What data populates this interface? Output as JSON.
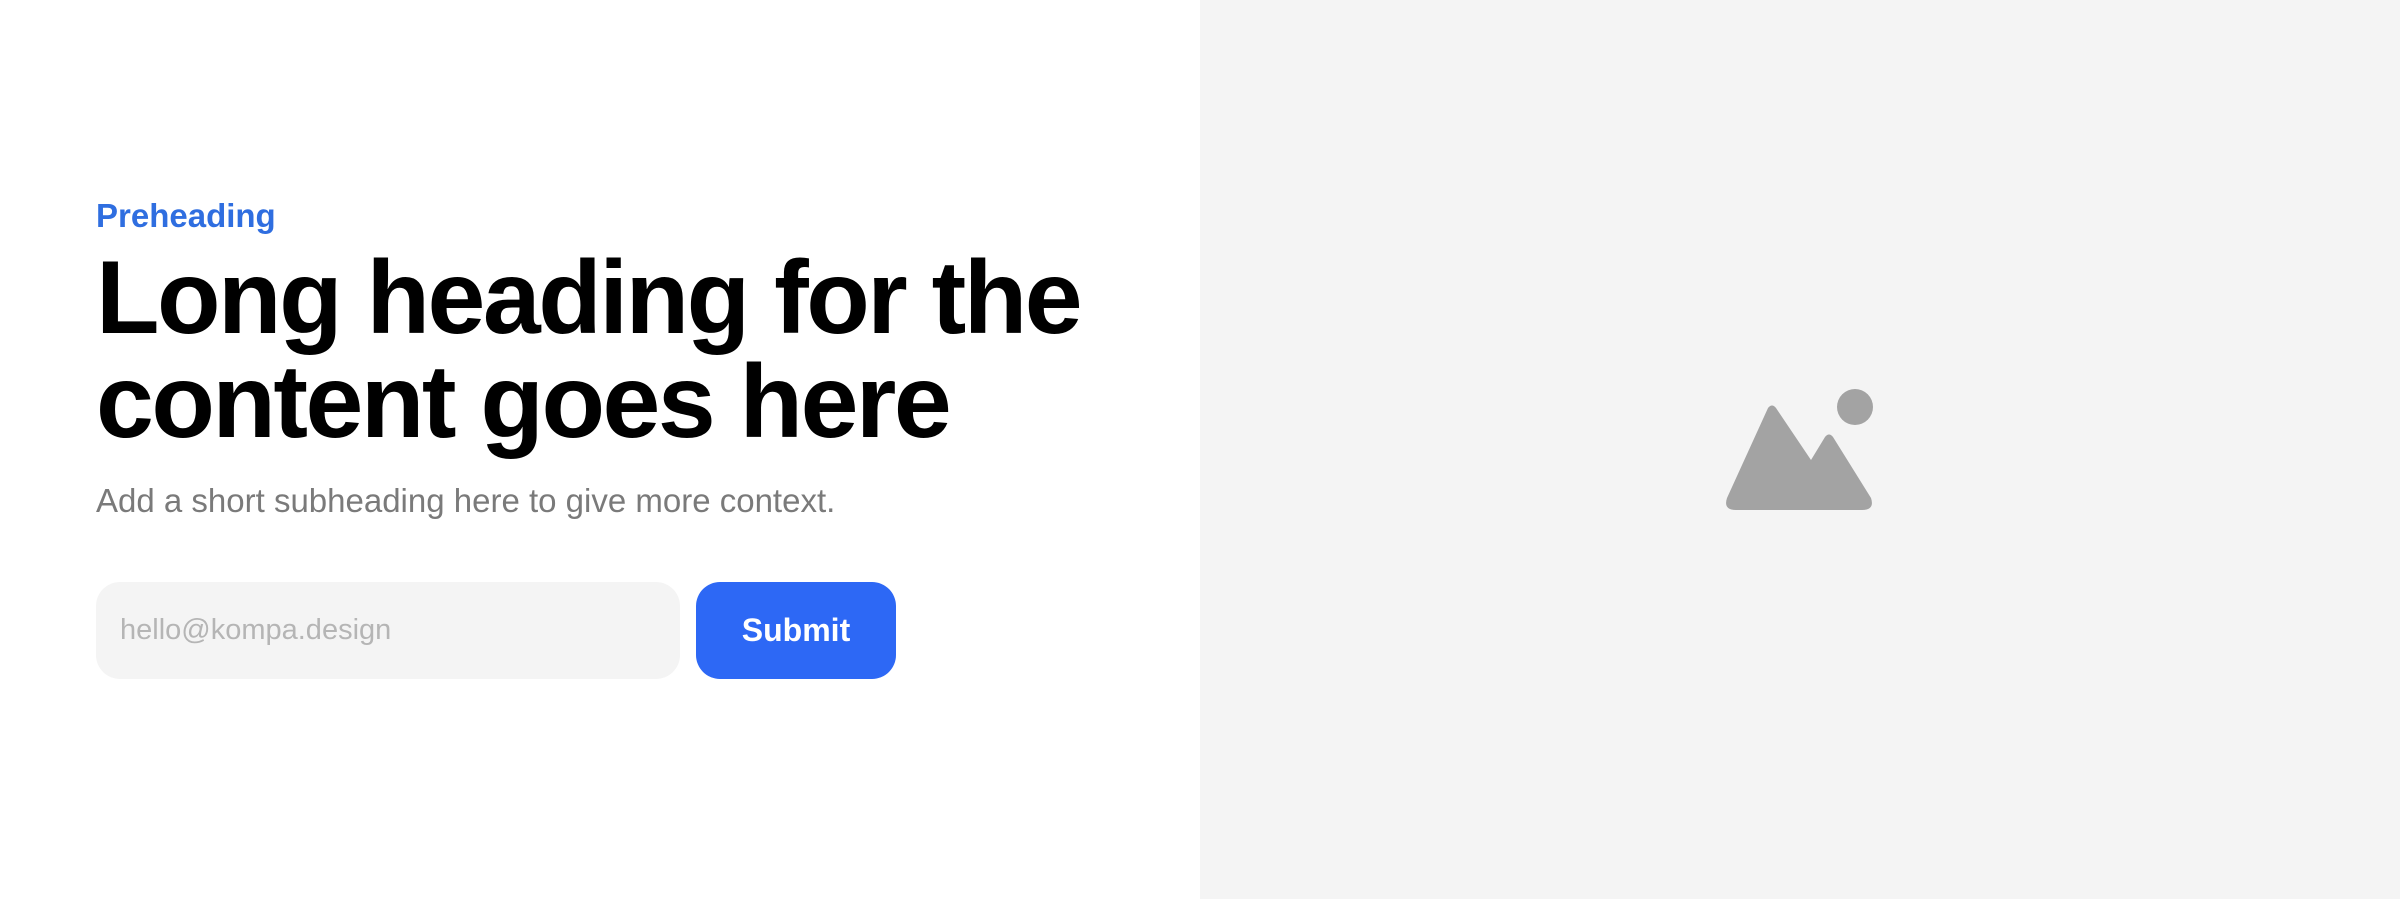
{
  "hero": {
    "preheading": "Preheading",
    "heading_line_1": "Long heading for the",
    "heading_line_2": "content goes here",
    "subheading": "Add a short subheading here to give more context."
  },
  "form": {
    "email_placeholder": "hello@kompa.design",
    "email_value": "",
    "submit_label": "Submit"
  },
  "media": {
    "icon": "image-placeholder-icon",
    "background_color": "#f4f4f4",
    "icon_color": "#a3a3a3"
  },
  "colors": {
    "accent": "#2f6ee0",
    "button": "#2d68f5",
    "heading": "#000000",
    "subheading": "#7a7a7a"
  }
}
